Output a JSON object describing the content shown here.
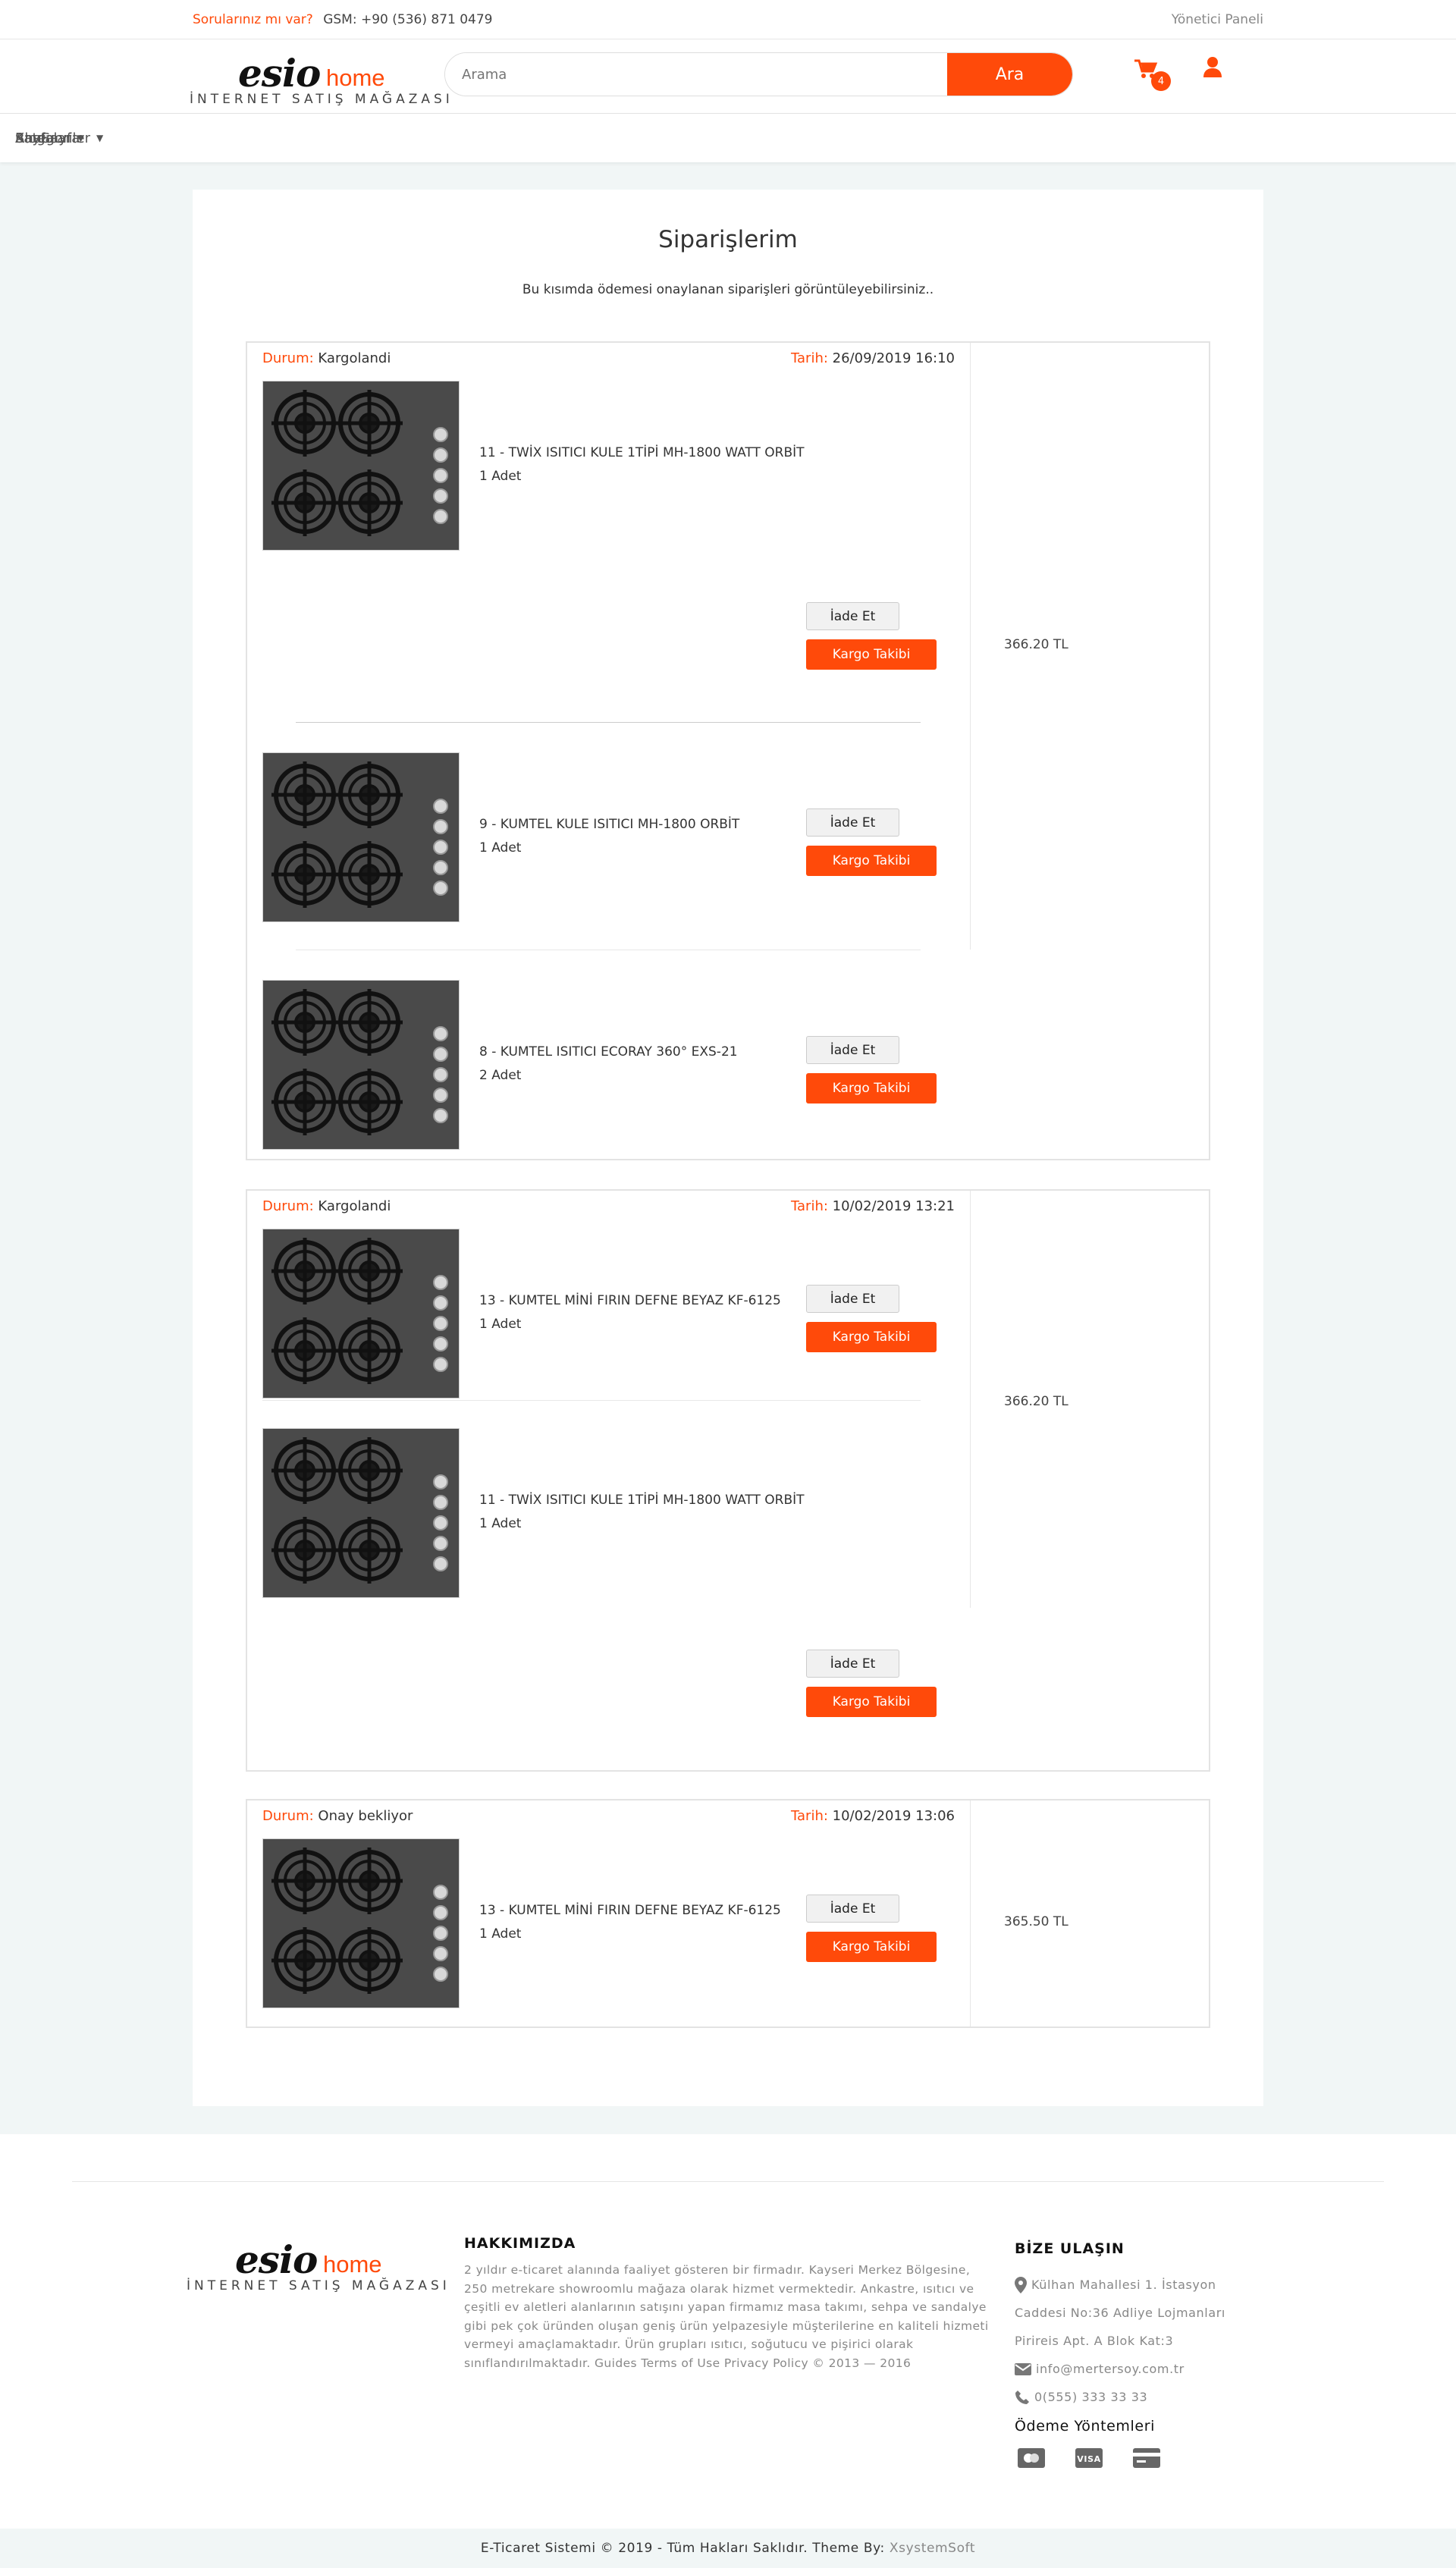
{
  "topbar": {
    "question": "Sorularınız mı var?",
    "gsm": "GSM: +90 (536) 871 0479",
    "admin": "Yönetici Paneli"
  },
  "brand": {
    "mark": "esio",
    "home": "home",
    "subtitle": "İNTERNET SATIŞ MAĞAZASI"
  },
  "search": {
    "placeholder": "Arama",
    "button": "Ara"
  },
  "cart": {
    "count": "4"
  },
  "nav": {
    "items": [
      "AnaSayfa",
      "Kategoriler",
      "Sayfalar",
      "Blog"
    ]
  },
  "page": {
    "title": "Siparişlerim",
    "intro": "Bu kısımda ödemesi onaylanan siparişleri görüntüleyebilirsiniz.."
  },
  "labels": {
    "status": "Durum:",
    "date": "Tarih:",
    "return": "İade Et",
    "tracking": "Kargo Takibi"
  },
  "orders": [
    {
      "status": "Kargolandi",
      "date": "26/09/2019 16:10",
      "total": "366.20 TL",
      "items": [
        {
          "name": "11 - TWİX ISITICI KULE 1TİPİ MH-1800 WATT ORBİT",
          "qty": "1 Adet"
        },
        {
          "name": "9 - KUMTEL KULE ISITICI MH-1800 ORBİT",
          "qty": "1 Adet"
        },
        {
          "name": "8 - KUMTEL ISITICI ECORAY 360° EXS-21",
          "qty": "2 Adet"
        }
      ]
    },
    {
      "status": "Kargolandi",
      "date": "10/02/2019 13:21",
      "total": "366.20 TL",
      "items": [
        {
          "name": "13 - KUMTEL MİNİ FIRIN DEFNE BEYAZ KF-6125",
          "qty": "1 Adet"
        },
        {
          "name": "11 - TWİX ISITICI KULE 1TİPİ MH-1800 WATT ORBİT",
          "qty": "1 Adet"
        }
      ]
    },
    {
      "status": "Onay bekliyor",
      "date": "10/02/2019 13:06",
      "total": "365.50 TL",
      "items": [
        {
          "name": "13 - KUMTEL MİNİ FIRIN DEFNE BEYAZ KF-6125",
          "qty": "1 Adet"
        }
      ]
    }
  ],
  "footer": {
    "about_title": "HAKKIMIZDA",
    "about_text": "2 yıldır e-ticaret alanında faaliyet gösteren bir firmadır. Kayseri Merkez Bölgesine, 250 metrekare showroomlu mağaza olarak hizmet vermektedir. Ankastre, ısıtıcı ve çeşitli ev aletleri alanlarının satışını yapan firmamız masa takımı, sehpa ve sandalye gibi pek çok üründen oluşan geniş ürün yelpazesiyle müşterilerine en kaliteli hizmeti vermeyi amaçlamaktadır. Ürün grupları ısıtıcı, soğutucu ve pişirici olarak sınıflandırılmaktadır. Guides Terms of Use Privacy Policy © 2013 — 2016",
    "contact_title": "BİZE ULAŞIN",
    "address1": "Külhan Mahallesi 1. İstasyon",
    "address2": "Caddesi No:36 Adliye Lojmanları",
    "address3": "Piri̇reis Apt. A Blok Kat:3",
    "email": "info@mertersoy.com.tr",
    "phone": "0(555) 333 33 33",
    "payment_title": "Ödeme Yöntemleri",
    "copyright": "E-Ticaret Sistemi © 2019 - Tüm Hakları Saklıdır. Theme By:",
    "theme_by": "XsystemSoft"
  }
}
